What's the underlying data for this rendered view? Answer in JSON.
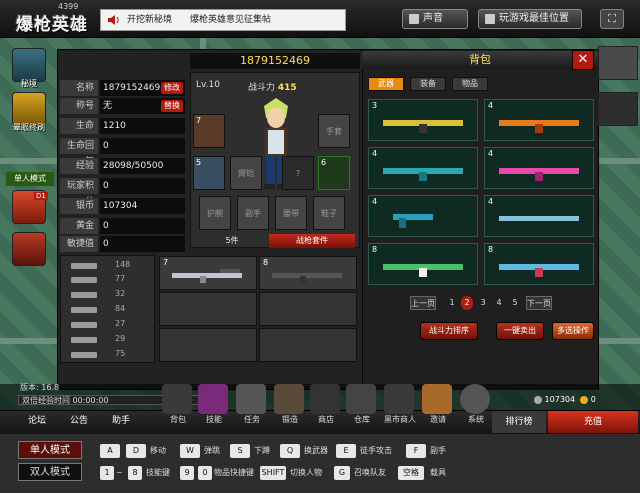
{
  "logo": {
    "sub": "4399",
    "main": "爆枪英雄"
  },
  "notice": {
    "items": [
      "开挖新秘境",
      "爆枪英雄意见征集帖"
    ]
  },
  "top_buttons": {
    "sound": "声音",
    "best_position": "玩游戏最佳位置"
  },
  "side": {
    "secret": "秘境",
    "rank_label": "晕眼终刷",
    "single_mode": "单人模式",
    "badge": "D1"
  },
  "stats": {
    "rows": [
      {
        "label": "名称",
        "value": "1879152469",
        "btn": "修改"
      },
      {
        "label": "称号",
        "value": "无",
        "btn": "替换"
      },
      {
        "label": "生命",
        "value": "1210"
      },
      {
        "label": "生命回复",
        "value": "0"
      },
      {
        "label": "经验",
        "value": "28098/50500"
      },
      {
        "label": "玩家积分",
        "value": "0"
      },
      {
        "label": "银币",
        "value": "107304"
      },
      {
        "label": "黄金",
        "value": "0"
      },
      {
        "label": "敏捷值",
        "value": "0"
      }
    ]
  },
  "player": {
    "name": "1879152469",
    "level": "Lv.10",
    "power_label": "战斗力",
    "power_value": "415"
  },
  "equip_slots": {
    "s7": "7",
    "s5": "5",
    "s6": "6",
    "weapon": "手套",
    "cap": "臂铠",
    "r2": "?",
    "b1": "护腕",
    "b2": "副手",
    "b3": "腰带",
    "b4": "鞋子"
  },
  "tabs": {
    "five": "5件",
    "suit": "战枪套件"
  },
  "weapons_list": {
    "values": [
      "148",
      "77",
      "32",
      "84",
      "27",
      "29",
      "75"
    ]
  },
  "weapon_slots": {
    "a": "7",
    "b": "8"
  },
  "bag": {
    "title": "背包",
    "tabs": [
      "武器",
      "装备",
      "物品"
    ],
    "items": [
      "3",
      "4",
      "4",
      "4",
      "4",
      "4",
      "8",
      "8"
    ],
    "pages": [
      "上一页",
      "1",
      "2",
      "3",
      "4",
      "5",
      "下一页"
    ],
    "actions": [
      "战斗力排序",
      "一键卖出",
      "多选操作"
    ]
  },
  "bottom": {
    "version": "版本: 16.8",
    "exp_label": "双倍经验时间",
    "exp_value": "00:00:00",
    "menu_left": [
      "论坛",
      "公告",
      "助手"
    ],
    "icons": [
      "背包",
      "技能",
      "任务",
      "锻造",
      "商店",
      "仓库",
      "黑市商人",
      "邀请",
      "系统"
    ],
    "money": "107304",
    "money2": "0",
    "rank": "排行榜",
    "charge": "充值"
  },
  "modes": {
    "single": "单人模式",
    "double": "双人模式"
  },
  "keys_row1": [
    {
      "k": "A",
      "t": ""
    },
    {
      "k": "D",
      "t": "移动"
    },
    {
      "k": "W",
      "t": "弹跳"
    },
    {
      "k": "S",
      "t": "下蹲"
    },
    {
      "k": "Q",
      "t": "换武器"
    },
    {
      "k": "E",
      "t": "徒手攻击"
    },
    {
      "k": "F",
      "t": "副手"
    }
  ],
  "keys_row2": [
    {
      "k": "1",
      "t": "~"
    },
    {
      "k": "8",
      "t": "技能键"
    },
    {
      "k": "9",
      "t": ""
    },
    {
      "k": "0",
      "t": "物品快捷键"
    },
    {
      "k": "SHIFT",
      "t": "切换人物"
    },
    {
      "k": "G",
      "t": "召唤队友"
    },
    {
      "k": "空格",
      "t": "载具"
    }
  ]
}
